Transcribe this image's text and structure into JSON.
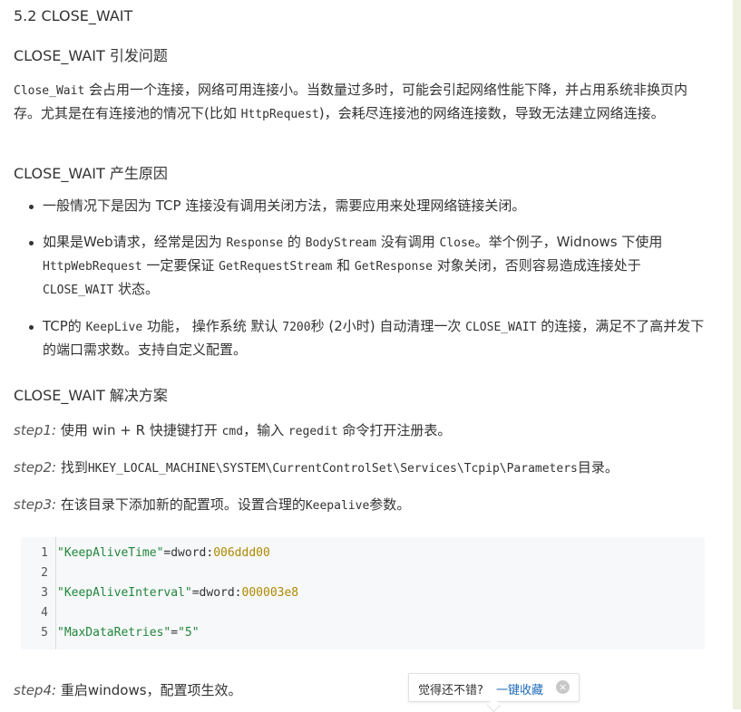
{
  "section_title": "5.2 CLOSE_WAIT",
  "problems": {
    "heading": "CLOSE_WAIT 引发问题",
    "text": [
      {
        "t": "Close_Wait",
        "code": true
      },
      {
        "t": " 会占用一个连接，网络可用连接小。当数量过多时，可能会引起网络性能下降，并占用系统非换页内存。尤其是在有连接池的情况下(比如 ",
        "code": false
      },
      {
        "t": "HttpRequest",
        "code": true
      },
      {
        "t": ")，会耗尽连接池的网络连接数，导致无法建立网络连接。",
        "code": false
      }
    ]
  },
  "causes": {
    "heading": "CLOSE_WAIT 产生原因",
    "items": [
      [
        {
          "t": "一般情况下是因为 TCP 连接没有调用关闭方法，需要应用来处理网络链接关闭。",
          "code": false
        }
      ],
      [
        {
          "t": "如果是Web请求，经常是因为 ",
          "code": false
        },
        {
          "t": "Response",
          "code": true
        },
        {
          "t": " 的 ",
          "code": false
        },
        {
          "t": "BodyStream",
          "code": true
        },
        {
          "t": " 没有调用 ",
          "code": false
        },
        {
          "t": "Close",
          "code": true
        },
        {
          "t": "。举个例子，Widnows 下使用 ",
          "code": false
        },
        {
          "t": "HttpWebRequest",
          "code": true
        },
        {
          "t": " 一定要保证 ",
          "code": false
        },
        {
          "t": "GetRequestStream",
          "code": true
        },
        {
          "t": " 和 ",
          "code": false
        },
        {
          "t": "GetResponse",
          "code": true
        },
        {
          "t": " 对象关闭，否则容易造成连接处于 ",
          "code": false
        },
        {
          "t": "CLOSE_WAIT",
          "code": true
        },
        {
          "t": " 状态。",
          "code": false
        }
      ],
      [
        {
          "t": "TCP的 ",
          "code": false
        },
        {
          "t": "KeepLive",
          "code": true
        },
        {
          "t": " 功能， 操作系统 默认 ",
          "code": false
        },
        {
          "t": "7200",
          "code": true
        },
        {
          "t": "秒 (2小时) 自动清理一次 ",
          "code": false
        },
        {
          "t": "CLOSE_WAIT",
          "code": true
        },
        {
          "t": " 的连接，满足不了高并发下的端口需求数。支持自定义配置。",
          "code": false
        }
      ]
    ]
  },
  "solution": {
    "heading": "CLOSE_WAIT 解决方案",
    "steps": [
      {
        "label": "step1:",
        "parts": [
          {
            "t": " 使用 win + R 快捷键打开 ",
            "code": false
          },
          {
            "t": "cmd",
            "code": true
          },
          {
            "t": "，输入 ",
            "code": false
          },
          {
            "t": "regedit",
            "code": true
          },
          {
            "t": " 命令打开注册表。",
            "code": false
          }
        ]
      },
      {
        "label": "step2:",
        "parts": [
          {
            "t": " 找到",
            "code": false
          },
          {
            "t": "HKEY_LOCAL_MACHINE\\SYSTEM\\CurrentControlSet\\Services\\Tcpip\\Parameters",
            "code": true
          },
          {
            "t": "目录。",
            "code": false
          }
        ]
      },
      {
        "label": "step3:",
        "parts": [
          {
            "t": " 在该目录下添加新的配置项。设置合理的",
            "code": false
          },
          {
            "t": "Keepalive",
            "code": true
          },
          {
            "t": "参数。",
            "code": false
          }
        ]
      },
      {
        "label": "step4:",
        "parts": [
          {
            "t": " 重启windows，配置项生效。",
            "code": false
          }
        ]
      }
    ]
  },
  "code_block": {
    "line_numbers": [
      "1",
      "2",
      "3",
      "4",
      "5"
    ],
    "lines": [
      {
        "key": "\"KeepAliveTime\"",
        "op": "=dword:",
        "val": "006ddd00"
      },
      {
        "key": "",
        "op": "",
        "val": ""
      },
      {
        "key": "\"KeepAliveInterval\"",
        "op": "=dword:",
        "val": "000003e8"
      },
      {
        "key": "",
        "op": "",
        "val": ""
      },
      {
        "key": "\"MaxDataRetries\"",
        "op": "=",
        "val": "\"5\"",
        "val_is_string": true
      }
    ]
  },
  "popup": {
    "text": "觉得还不错?",
    "action": "一键收藏",
    "close_icon": "×"
  }
}
